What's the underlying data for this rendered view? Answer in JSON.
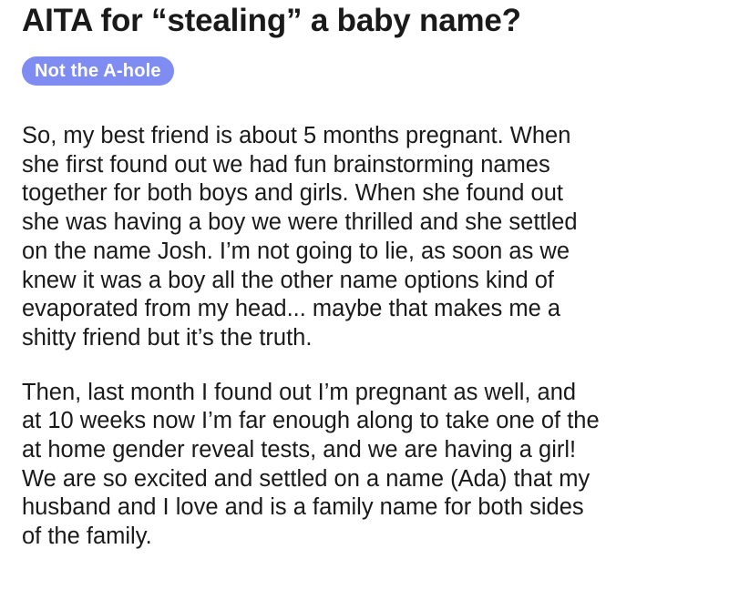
{
  "post": {
    "title": "AITA for “stealing” a baby name?",
    "flair": "Not the A-hole",
    "flair_color": "#7f8cf2",
    "paragraphs": [
      {
        "lines": [
          "So, my best friend is about 5 months pregnant. When",
          "she first found out we had fun brainstorming names",
          "together for both boys and girls.  When she found out",
          "she was having a boy we were thrilled and she settled",
          "on the name Josh.  I’m not going to lie, as soon as we",
          "knew it was a boy all the other name options kind of",
          "evaporated from my head... maybe that makes me a",
          "shitty friend but it’s the truth."
        ]
      },
      {
        "lines": [
          "Then, last month I found out I’m pregnant as well, and",
          "at 10 weeks now I’m far enough along to take one of the",
          "at home gender reveal tests, and we are having a girl!",
          "We are so excited and settled on a name (Ada) that my",
          "husband and I love and is a family name for both sides",
          "of the family."
        ]
      }
    ]
  }
}
